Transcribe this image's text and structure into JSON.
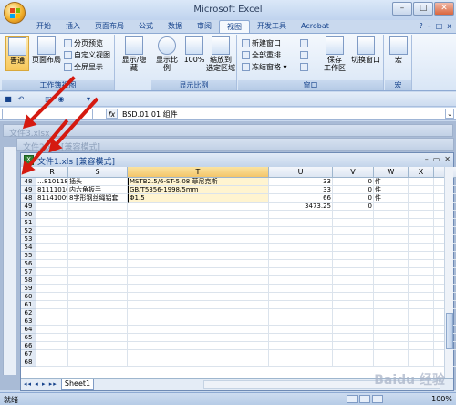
{
  "app": {
    "title": "Microsoft Excel"
  },
  "tabs": [
    "开始",
    "插入",
    "页面布局",
    "公式",
    "数据",
    "审阅",
    "视图",
    "开发工具",
    "Acrobat"
  ],
  "active_tab": "视图",
  "ribbon": {
    "workbook_views": {
      "label": "工作簿视图",
      "normal": "普通",
      "page_layout": "页面布局",
      "page_break": "分页预览",
      "custom": "自定义视图",
      "full_screen": "全屏显示"
    },
    "show_hide": {
      "label": "显示/隐藏"
    },
    "zoom": {
      "label": "显示比例",
      "zoom": "显示比例",
      "hundred": "100%",
      "zoom_sel_1": "缩放到",
      "zoom_sel_2": "选定区域"
    },
    "window": {
      "label": "窗口",
      "new_window": "新建窗口",
      "arrange_all": "全部重排",
      "freeze": "冻结窗格",
      "save_workspace_1": "保存",
      "save_workspace_2": "工作区",
      "switch_windows": "切换窗口"
    },
    "macros": {
      "label": "宏",
      "macros": "宏"
    }
  },
  "formula_bar": {
    "fx": "fx",
    "content": "BSD.01.01 组件"
  },
  "bg_windows": [
    {
      "title": "文件3.xlsx"
    },
    {
      "title": "文件2.xls  [兼容模式]"
    }
  ],
  "child_window": {
    "title": "文件1.xls  [兼容模式]"
  },
  "grid": {
    "columns": [
      "R",
      "S",
      "T",
      "U",
      "V",
      "W",
      "X",
      "Y"
    ],
    "rows": [
      {
        "num": "48",
        "cells": [
          "…810118",
          "插头",
          "MSTB2.5/6-ST-5.08 菲尼克斯",
          "33",
          "0",
          "件",
          "",
          ""
        ]
      },
      {
        "num": "49",
        "cells": [
          "811110105",
          "内六角扳手",
          "GB/T5356-1998/5mm",
          "33",
          "0",
          "件",
          "",
          ""
        ]
      },
      {
        "num": "48",
        "cells": [
          "811410090",
          "8字形钢丝绳铝套",
          "Φ1.5",
          "66",
          "0",
          "件",
          "",
          ""
        ]
      },
      {
        "num": "49",
        "cells": [
          "",
          "",
          "",
          "3473.25",
          "0",
          "",
          "",
          ""
        ]
      },
      {
        "num": "50"
      },
      {
        "num": "51"
      },
      {
        "num": "52"
      },
      {
        "num": "53"
      },
      {
        "num": "54"
      },
      {
        "num": "55"
      },
      {
        "num": "56"
      },
      {
        "num": "57"
      },
      {
        "num": "58"
      },
      {
        "num": "59"
      },
      {
        "num": "60"
      },
      {
        "num": "61"
      },
      {
        "num": "62"
      },
      {
        "num": "63"
      },
      {
        "num": "64"
      },
      {
        "num": "65"
      },
      {
        "num": "66"
      },
      {
        "num": "67"
      },
      {
        "num": "68"
      }
    ]
  },
  "sheet_tab": "Sheet1",
  "status": {
    "ready": "就绪",
    "zoom": "100%"
  },
  "watermark": "Baidu 经验",
  "colors": {
    "arrow": "#d51a10",
    "selected_column": "#f3c56a"
  }
}
